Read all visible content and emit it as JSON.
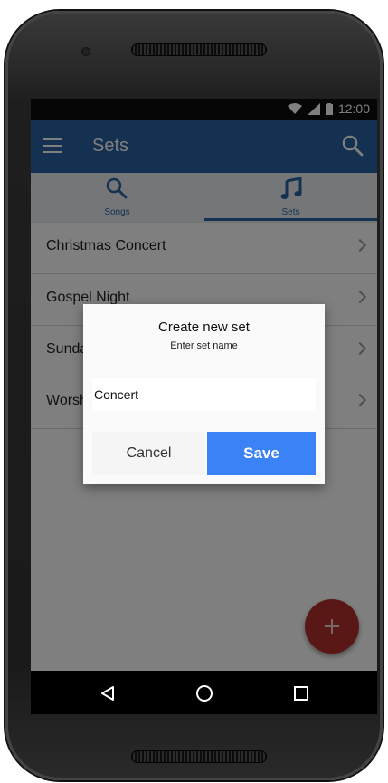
{
  "status_bar": {
    "time": "12:00"
  },
  "app_bar": {
    "title": "Sets",
    "menu_icon": "hamburger-menu-icon",
    "search_icon": "search-icon"
  },
  "tabs": [
    {
      "label": "Songs",
      "icon": "search-icon",
      "active": false
    },
    {
      "label": "Sets",
      "icon": "music-note-icon",
      "active": true
    }
  ],
  "sets": [
    {
      "name": "Christmas Concert"
    },
    {
      "name": "Gospel Night"
    },
    {
      "name": "Sunday Church"
    },
    {
      "name": "Worship"
    }
  ],
  "dialog": {
    "title": "Create new set",
    "subtitle": "Enter set name",
    "input_value": "Concert",
    "cancel_label": "Cancel",
    "save_label": "Save"
  },
  "fab": {
    "icon": "plus-icon"
  },
  "nav_bar": {
    "back_icon": "back-triangle-icon",
    "home_icon": "home-circle-icon",
    "recents_icon": "recents-square-icon"
  },
  "colors": {
    "primary": "#2b63a3",
    "accent": "#3b82f6",
    "fab": "#b3302b"
  }
}
